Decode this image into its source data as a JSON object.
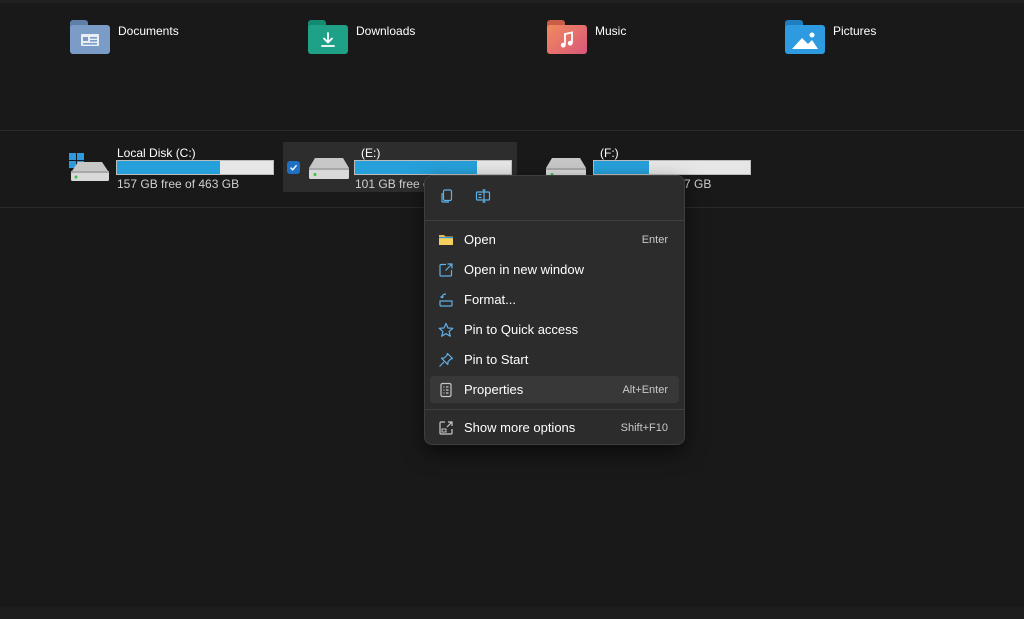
{
  "folders": [
    {
      "name": "Documents",
      "icon": "documents-folder-icon",
      "color": "#7a9cc6"
    },
    {
      "name": "Downloads",
      "icon": "downloads-folder-icon",
      "color": "#1fa187"
    },
    {
      "name": "Music",
      "icon": "music-folder-icon",
      "color": "#e8765a"
    },
    {
      "name": "Pictures",
      "icon": "pictures-folder-icon",
      "color": "#2e9be0"
    }
  ],
  "drives": [
    {
      "label": "Local Disk (C:)",
      "free_text": "157 GB free of 463 GB",
      "used_fraction": 0.66,
      "selected": false,
      "icon": "windows-drive-icon"
    },
    {
      "label": "(E:)",
      "free_text": "101 GB free of",
      "used_fraction": 0.78,
      "selected": true,
      "icon": "hard-drive-icon"
    },
    {
      "label": "(F:)",
      "free_text": "7 GB",
      "used_fraction": 0.35,
      "selected": false,
      "icon": "hard-drive-icon"
    }
  ],
  "context_menu": {
    "quick_actions": [
      {
        "icon": "copy-icon"
      },
      {
        "icon": "rename-icon"
      }
    ],
    "items": [
      {
        "label": "Open",
        "shortcut": "Enter",
        "icon": "folder-open-icon"
      },
      {
        "label": "Open in new window",
        "shortcut": "",
        "icon": "open-external-icon"
      },
      {
        "label": "Format...",
        "shortcut": "",
        "icon": "format-drive-icon"
      },
      {
        "label": "Pin to Quick access",
        "shortcut": "",
        "icon": "star-icon"
      },
      {
        "label": "Pin to Start",
        "shortcut": "",
        "icon": "pin-icon"
      },
      {
        "label": "Properties",
        "shortcut": "Alt+Enter",
        "icon": "properties-icon"
      }
    ],
    "more": {
      "label": "Show more options",
      "shortcut": "Shift+F10",
      "icon": "show-more-icon"
    }
  },
  "colors": {
    "background": "#191919",
    "menu_background": "#2c2c2c",
    "selection_background": "#2d2d2d",
    "usage_bar_fill": "#26a0da",
    "checkbox_accent": "#1f6fc3",
    "icon_accent": "#60b0e8"
  }
}
